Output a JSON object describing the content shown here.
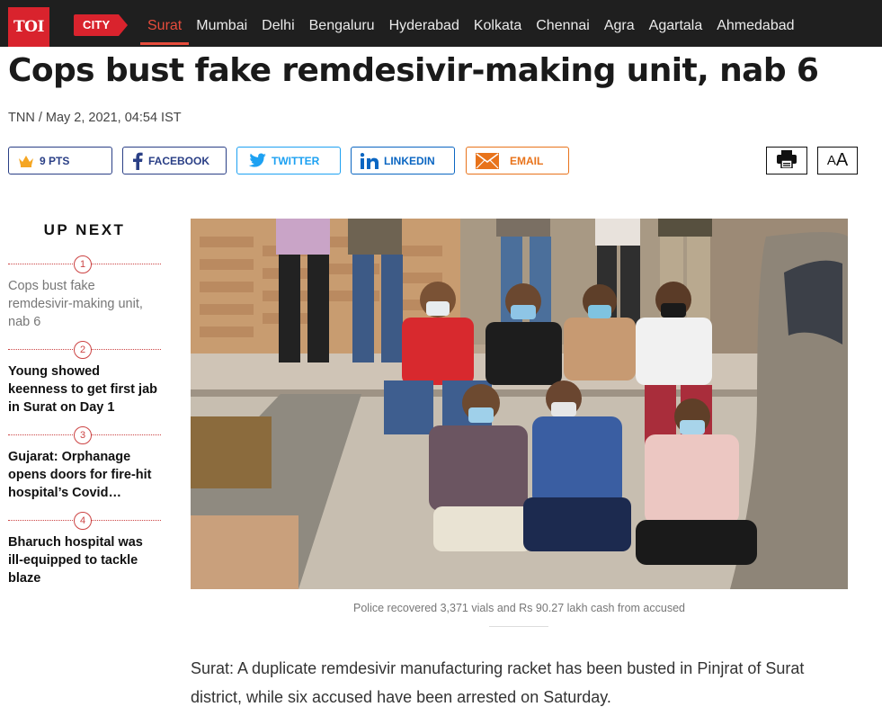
{
  "header": {
    "logo": "TOI",
    "section_tab": "CITY",
    "nav": [
      "Surat",
      "Mumbai",
      "Delhi",
      "Bengaluru",
      "Hyderabad",
      "Kolkata",
      "Chennai",
      "Agra",
      "Agartala",
      "Ahmedabad"
    ],
    "active_nav": "Surat"
  },
  "article": {
    "headline": "Cops bust fake remdesivir-making unit, nab 6",
    "byline": "TNN / May 2, 2021, 04:54 IST",
    "caption": "Police recovered 3,371 vials and Rs 90.27 lakh cash from accused",
    "body": "Surat: A duplicate remdesivir manufacturing racket has been busted in Pinjrat of Surat district, while six accused have been arrested on Saturday."
  },
  "share": {
    "points": "9 PTS",
    "facebook": "FACEBOOK",
    "twitter": "TWITTER",
    "linkedin": "LINKEDIN",
    "email": "EMAIL",
    "fontsize_small": "A",
    "fontsize_large": "A"
  },
  "up_next": {
    "title": "UP NEXT",
    "items": [
      {
        "num": "1",
        "text": "Cops bust fake remdesivir-making unit, nab 6"
      },
      {
        "num": "2",
        "text": "Young showed keenness to get first jab in Surat on Day 1"
      },
      {
        "num": "3",
        "text": "Gujarat: Orphanage opens doors for fire-hit hospital’s Covid…"
      },
      {
        "num": "4",
        "text": "Bharuch hospital was ill-equipped to tackle blaze"
      }
    ]
  },
  "colors": {
    "brand_red": "#d9232d",
    "nav_bg": "#1f1f1f",
    "facebook": "#2a3f86",
    "twitter": "#1da1f2",
    "linkedin": "#0b66c2",
    "email": "#e8731b"
  }
}
